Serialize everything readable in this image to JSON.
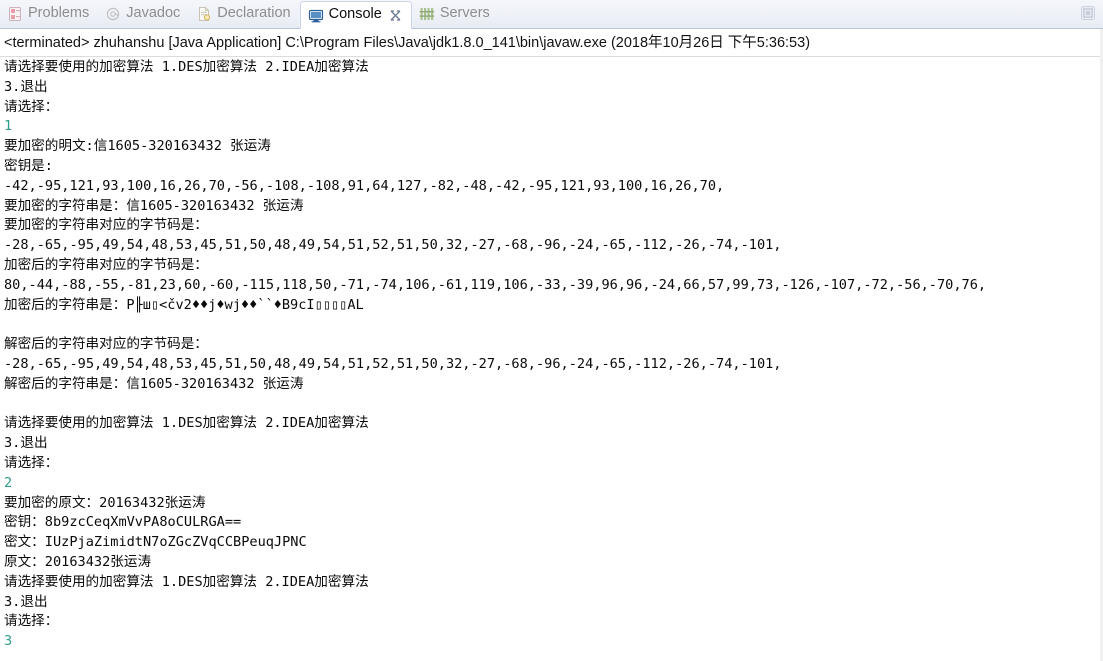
{
  "window": {
    "maximize_icon": "maximize-restore-icon"
  },
  "tabs": [
    {
      "label": "Problems",
      "icon": "problems-icon",
      "active": false,
      "closable": false
    },
    {
      "label": "Javadoc",
      "icon": "javadoc-icon",
      "active": false,
      "closable": false
    },
    {
      "label": "Declaration",
      "icon": "declaration-icon",
      "active": false,
      "closable": false
    },
    {
      "label": "Console",
      "icon": "console-icon",
      "active": true,
      "closable": true
    },
    {
      "label": "Servers",
      "icon": "servers-icon",
      "active": false,
      "closable": false
    }
  ],
  "console": {
    "header": "<terminated> zhuhanshu [Java Application] C:\\Program Files\\Java\\jdk1.8.0_141\\bin\\javaw.exe (2018年10月26日 下午5:36:53)",
    "input_color": "#2f9e88",
    "text_color": "#0a0a0a",
    "lines": [
      {
        "text": "请选择要使用的加密算法 1.DES加密算法 2.IDEA加密算法",
        "type": "output"
      },
      {
        "text": "3.退出",
        "type": "output"
      },
      {
        "text": "请选择：",
        "type": "output"
      },
      {
        "text": "1",
        "type": "input"
      },
      {
        "text": "要加密的明文:信1605-320163432 张运涛",
        "type": "output"
      },
      {
        "text": "密钥是:",
        "type": "output"
      },
      {
        "text": "-42,-95,121,93,100,16,26,70,-56,-108,-108,91,64,127,-82,-48,-42,-95,121,93,100,16,26,70,",
        "type": "output"
      },
      {
        "text": "要加密的字符串是：信1605-320163432 张运涛",
        "type": "output"
      },
      {
        "text": "要加密的字符串对应的字节码是：",
        "type": "output"
      },
      {
        "text": "-28,-65,-95,49,54,48,53,45,51,50,48,49,54,51,52,51,50,32,-27,-68,-96,-24,-65,-112,-26,-74,-101,",
        "type": "output"
      },
      {
        "text": "加密后的字符串对应的字节码是：",
        "type": "output"
      },
      {
        "text": "80,-44,-88,-55,-81,23,60,-60,-115,118,50,-71,-74,106,-61,119,106,-33,-39,96,96,-24,66,57,99,73,-126,-107,-72,-56,-70,76,",
        "type": "output"
      },
      {
        "text": "加密后的字符串是：P╟ш▯<čv2♦♦j♦wj♦♦``♦B9cI▯▯▯▯AL",
        "type": "output"
      },
      {
        "text": "",
        "type": "output"
      },
      {
        "text": "解密后的字符串对应的字节码是：",
        "type": "output"
      },
      {
        "text": "-28,-65,-95,49,54,48,53,45,51,50,48,49,54,51,52,51,50,32,-27,-68,-96,-24,-65,-112,-26,-74,-101,",
        "type": "output"
      },
      {
        "text": "解密后的字符串是：信1605-320163432 张运涛",
        "type": "output"
      },
      {
        "text": "",
        "type": "output"
      },
      {
        "text": "请选择要使用的加密算法 1.DES加密算法 2.IDEA加密算法",
        "type": "output"
      },
      {
        "text": "3.退出",
        "type": "output"
      },
      {
        "text": "请选择：",
        "type": "output"
      },
      {
        "text": "2",
        "type": "input"
      },
      {
        "text": "要加密的原文：20163432张运涛",
        "type": "output"
      },
      {
        "text": "密钥：8b9zcCeqXmVvPA8oCULRGA==",
        "type": "output"
      },
      {
        "text": "密文：IUzPjaZimidtN7oZGcZVqCCBPeuqJPNC",
        "type": "output"
      },
      {
        "text": "原文：20163432张运涛",
        "type": "output"
      },
      {
        "text": "请选择要使用的加密算法 1.DES加密算法 2.IDEA加密算法",
        "type": "output"
      },
      {
        "text": "3.退出",
        "type": "output"
      },
      {
        "text": "请选择：",
        "type": "output"
      },
      {
        "text": "3",
        "type": "input"
      }
    ]
  }
}
